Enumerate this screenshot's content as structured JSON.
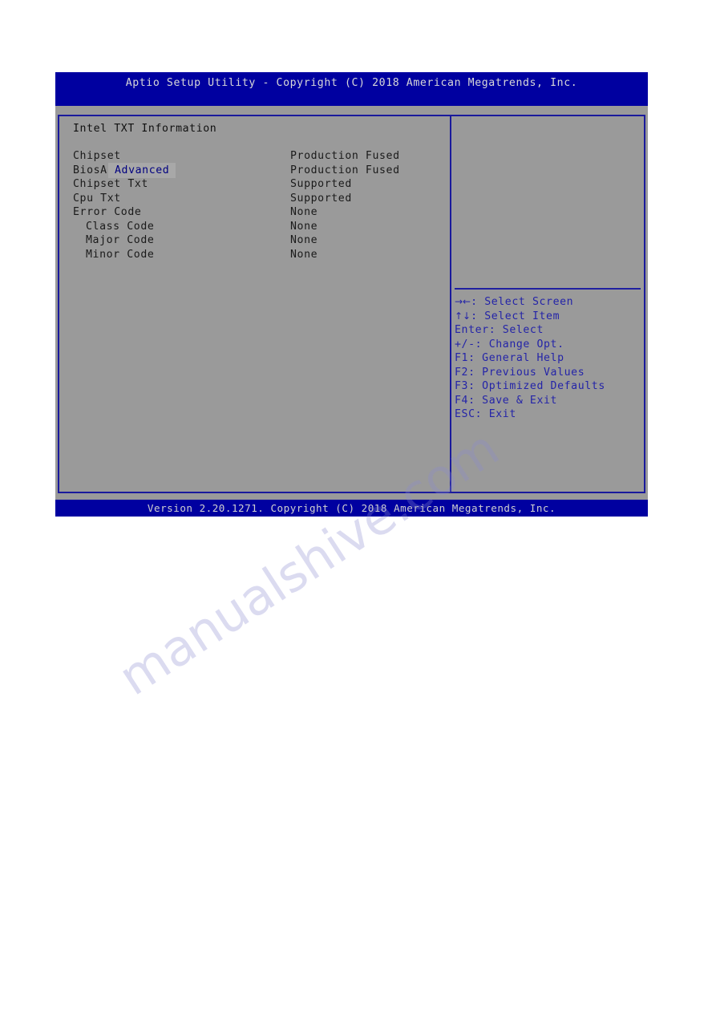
{
  "window": {
    "title": "Aptio Setup Utility - Copyright (C) 2018 American Megatrends, Inc.",
    "footer": "Version 2.20.1271. Copyright (C) 2018 American Megatrends, Inc."
  },
  "tabs": [
    {
      "label": "Advanced",
      "active": true
    }
  ],
  "main": {
    "heading": "Intel TXT Information",
    "rows": [
      {
        "label": "Chipset",
        "value": "Production Fused",
        "indent": false
      },
      {
        "label": "BiosAcm",
        "value": "Production Fused",
        "indent": false
      },
      {
        "label": "Chipset Txt",
        "value": "Supported",
        "indent": false
      },
      {
        "label": "Cpu Txt",
        "value": "Supported",
        "indent": false
      },
      {
        "label": "Error Code",
        "value": "None",
        "indent": false
      },
      {
        "label": "Class Code",
        "value": "None",
        "indent": true
      },
      {
        "label": "Major Code",
        "value": "None",
        "indent": true
      },
      {
        "label": "Minor Code",
        "value": "None",
        "indent": true
      }
    ]
  },
  "help": {
    "description": "",
    "keys": [
      {
        "glyph": "→←",
        "text": ": Select Screen"
      },
      {
        "glyph": "↑↓",
        "text": ": Select Item"
      },
      {
        "glyph": "",
        "text": "Enter: Select"
      },
      {
        "glyph": "",
        "text": "+/-: Change Opt."
      },
      {
        "glyph": "",
        "text": "F1: General Help"
      },
      {
        "glyph": "",
        "text": "F2: Previous Values"
      },
      {
        "glyph": "",
        "text": "F3: Optimized Defaults"
      },
      {
        "glyph": "",
        "text": "F4: Save & Exit"
      },
      {
        "glyph": "",
        "text": "ESC: Exit"
      }
    ]
  },
  "watermark": {
    "text": "manualshive.com"
  },
  "colors": {
    "header_blue": "#0000a0",
    "panel_gray": "#9a9a9a",
    "border_blue": "#1a1a9c",
    "help_text_blue": "#2424a8",
    "tab_bg": "#a8a8a8",
    "tab_text": "#000080"
  }
}
